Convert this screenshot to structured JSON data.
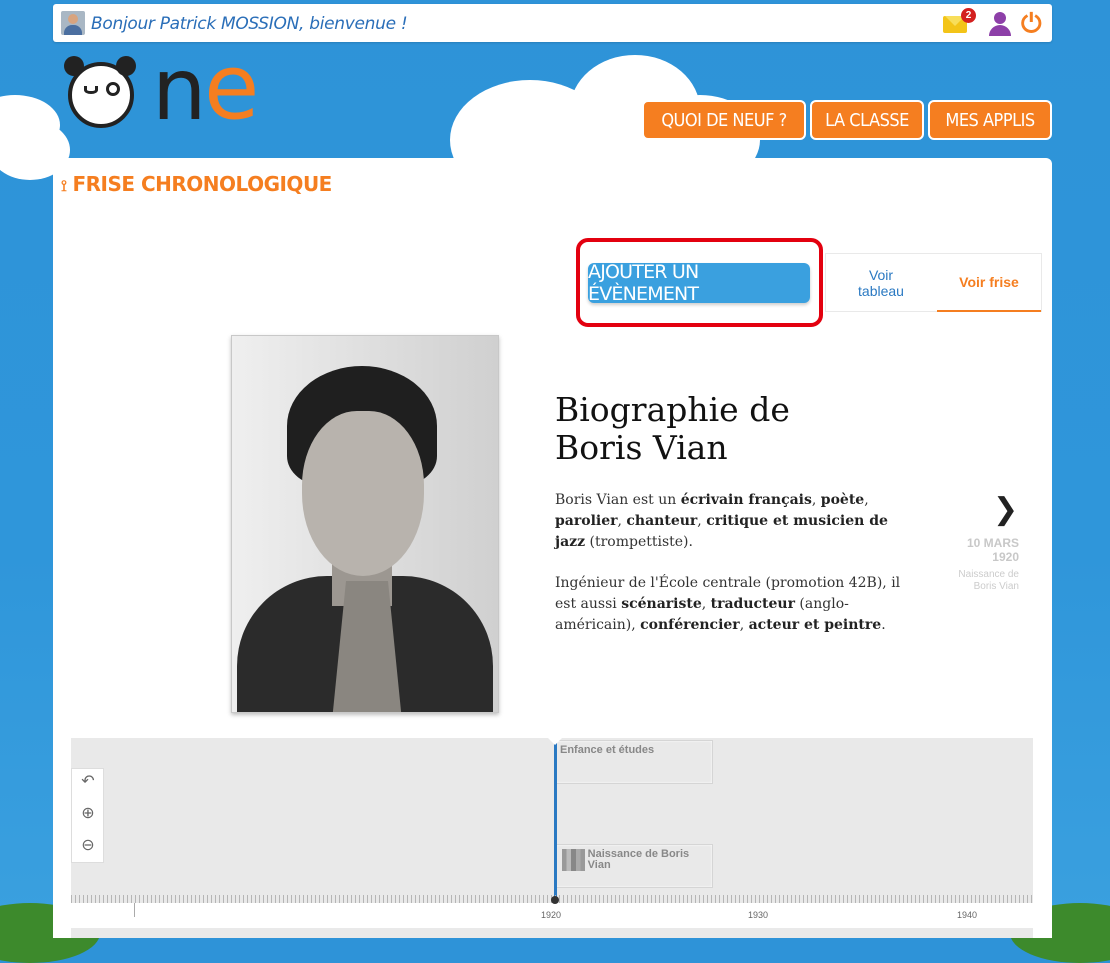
{
  "topbar": {
    "greeting": "Bonjour Patrick MOSSION, bienvenue !",
    "mail_count": "2"
  },
  "nav": {
    "whats_new": "QUOI DE NEUF ?",
    "class": "LA CLASSE",
    "apps": "MES APPLIS"
  },
  "page": {
    "title": "FRISE CHRONOLOGIQUE"
  },
  "actions": {
    "add_event": "AJOUTER UN ÉVÈNEMENT",
    "view_table_line1": "Voir",
    "view_table_line2": "tableau",
    "view_timeline": "Voir frise"
  },
  "event": {
    "title_line1": "Biographie de",
    "title_line2": "Boris Vian",
    "p1": {
      "t1": "Boris Vian est un ",
      "b1": "écrivain français",
      "t2": ", ",
      "b2": "poète",
      "t3": ", ",
      "b3": "parolier",
      "t4": ", ",
      "b4": "chanteur",
      "t5": ", ",
      "b5": "critique et musicien de jazz",
      "t6": " (trompettiste)."
    },
    "p2": {
      "t1": "Ingénieur de l'École centrale (promotion 42B), il est aussi ",
      "b1": "scénariste",
      "t2": ", ",
      "b2": "traducteur",
      "t3": " (anglo-américain), ",
      "b3": "conférencier",
      "t4": ", ",
      "b4": "acteur et peintre",
      "t5": "."
    }
  },
  "next": {
    "date_line1": "10 MARS",
    "date_line2": "1920",
    "label_line1": "Naissance de",
    "label_line2": "Boris Vian"
  },
  "timeline": {
    "cards": [
      "Enfance et études",
      "Naissance de Boris Vian"
    ],
    "years": [
      "1920",
      "1930",
      "1940"
    ]
  },
  "colors": {
    "accent": "#f57e20",
    "primary": "#3aa0df",
    "highlight": "#e3000f"
  }
}
